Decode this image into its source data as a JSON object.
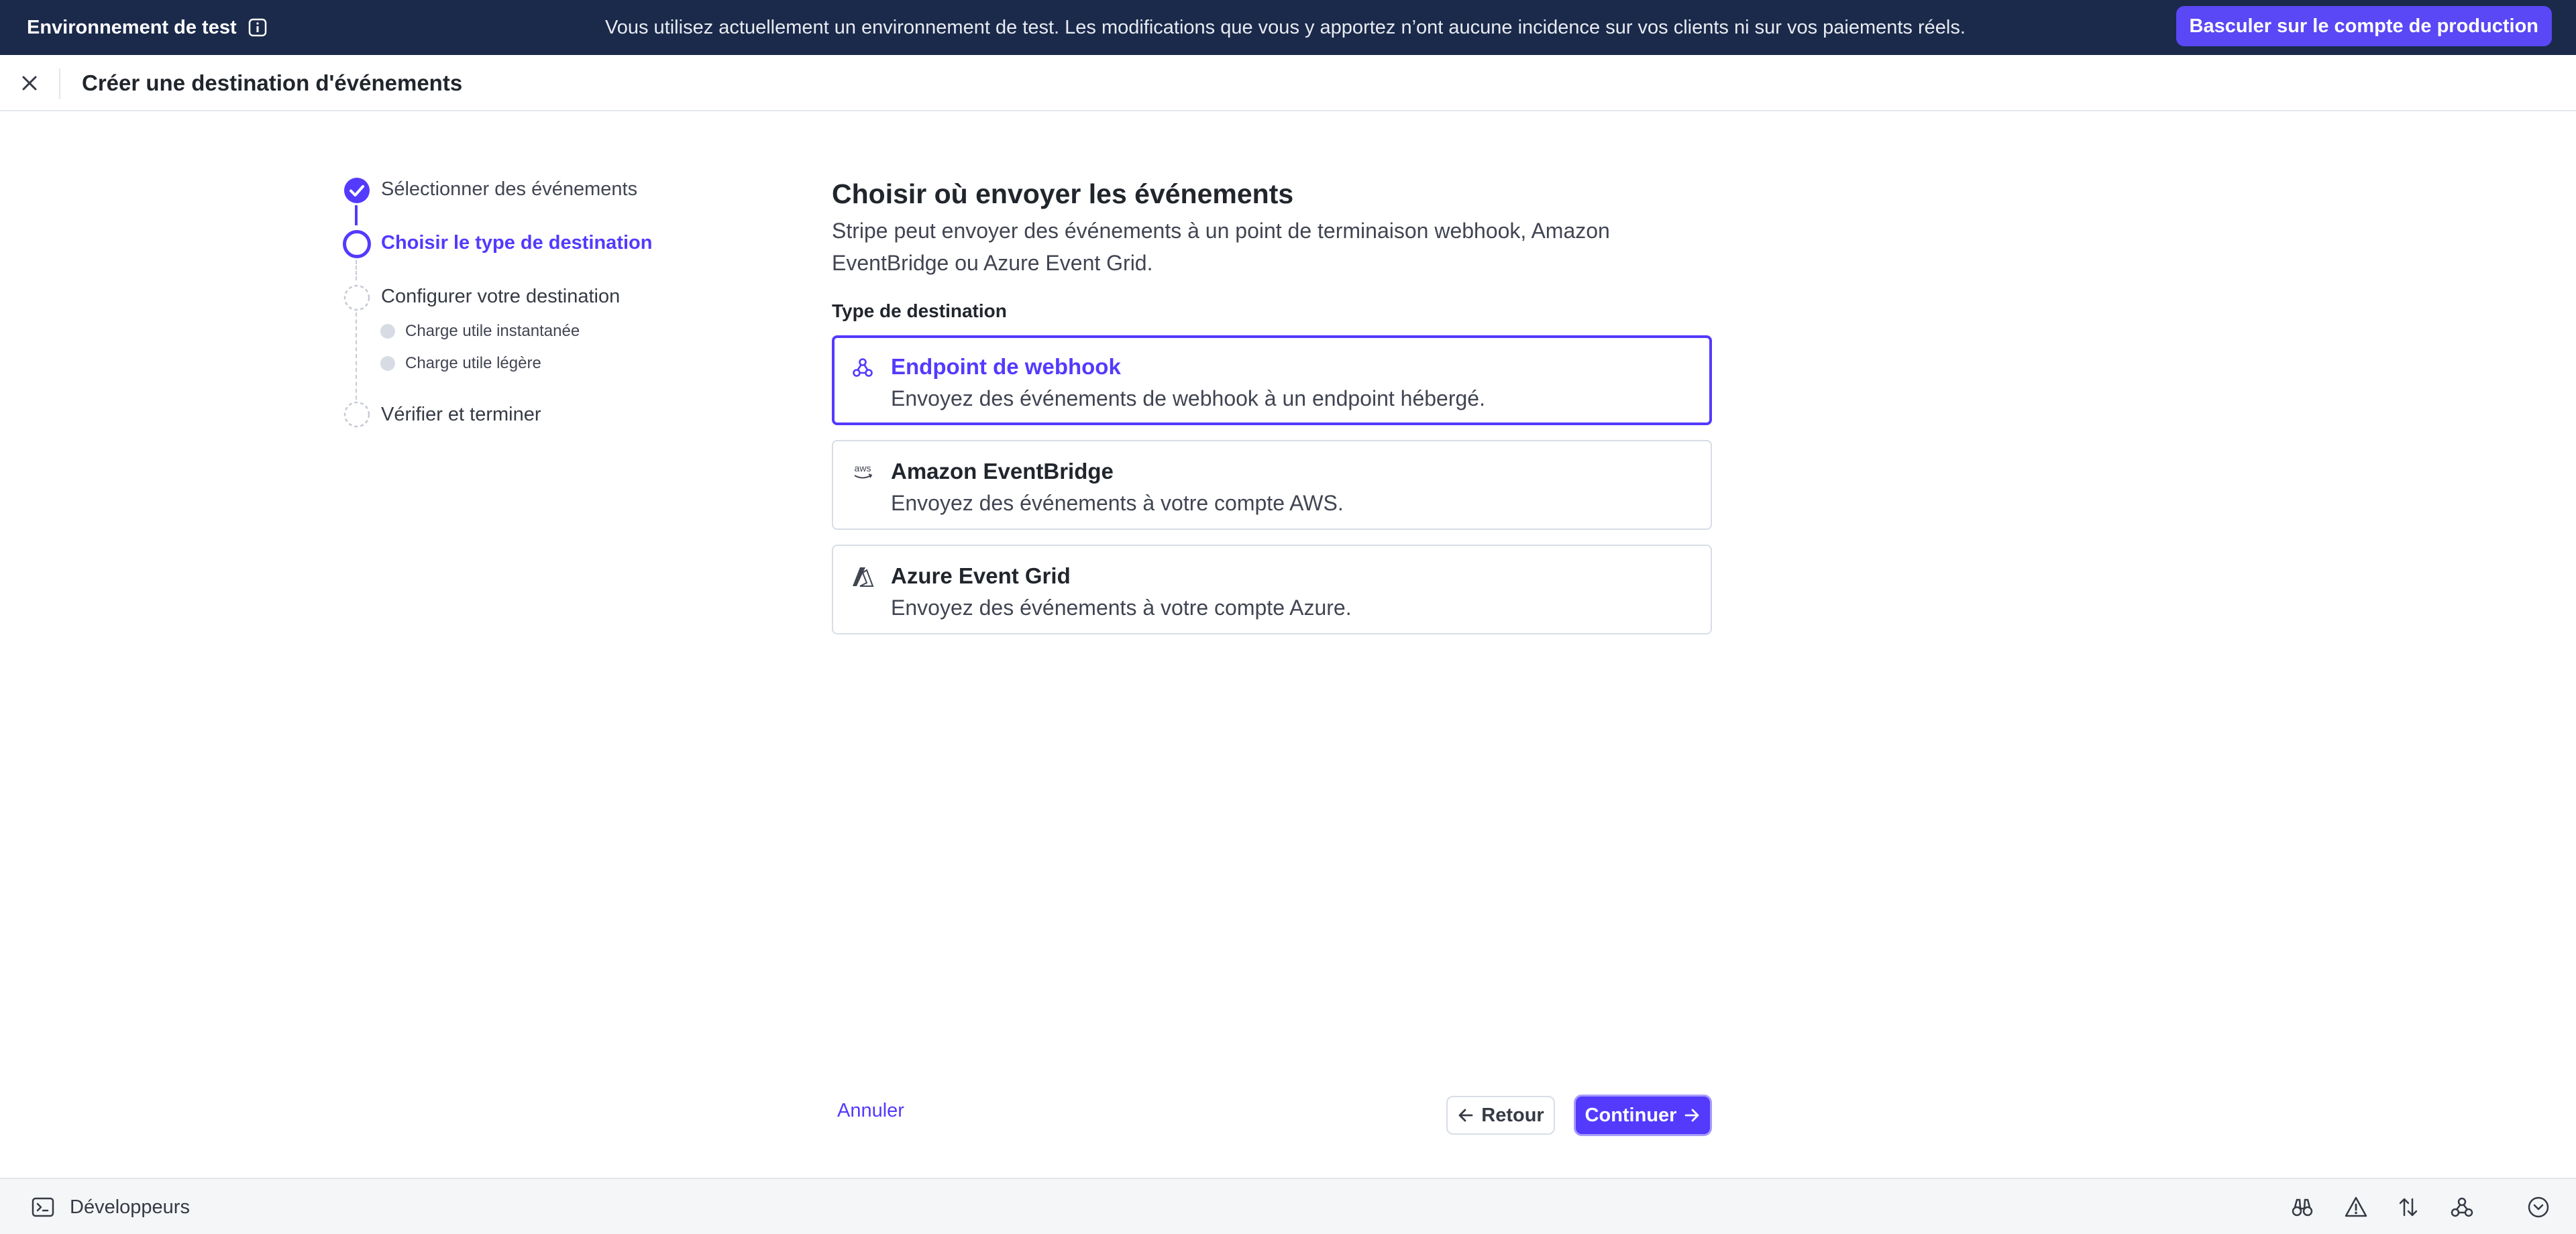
{
  "banner": {
    "env_title": "Environnement de test",
    "message": "Vous utilisez actuellement un environnement de test. Les modifications que vous y apportez n’ont aucune incidence sur vos clients ni sur vos paiements réels.",
    "prod_button": "Basculer sur le compte de production",
    "bg_color": "#1b2a4a",
    "button_color": "#5a47f5"
  },
  "header": {
    "title": "Créer une destination d'événements",
    "close_icon": "close-icon"
  },
  "steps": [
    {
      "label": "Sélectionner des événements",
      "status": "done"
    },
    {
      "label": "Choisir le type de destination",
      "status": "active"
    },
    {
      "label": "Configurer votre destination",
      "status": "pending",
      "substeps": [
        "Charge utile instantanée",
        "Charge utile légère"
      ]
    },
    {
      "label": "Vérifier et terminer",
      "status": "pending"
    }
  ],
  "main": {
    "title": "Choisir où envoyer les événements",
    "description": "Stripe peut envoyer des événements à un point de terminaison webhook, Amazon EventBridge ou Azure Event Grid.",
    "section_label": "Type de destination",
    "options": [
      {
        "title": "Endpoint de webhook",
        "description": "Envoyez des événements de webhook à un endpoint hébergé.",
        "icon": "webhook-icon",
        "selected": true
      },
      {
        "title": "Amazon EventBridge",
        "description": "Envoyez des événements à votre compte AWS.",
        "icon": "aws-icon",
        "selected": false
      },
      {
        "title": "Azure Event Grid",
        "description": "Envoyez des événements à votre compte Azure.",
        "icon": "azure-icon",
        "selected": false
      }
    ]
  },
  "footer": {
    "cancel": "Annuler",
    "back": "Retour",
    "continue": "Continuer"
  },
  "dev_bar": {
    "label": "Développeurs",
    "tools": [
      "binoculars-icon",
      "warning-icon",
      "sort-arrows-icon",
      "webhook-icon",
      "chevron-down-circle-icon"
    ]
  },
  "colors": {
    "accent": "#533afd",
    "text": "#353a44",
    "border": "#d8dde6"
  }
}
